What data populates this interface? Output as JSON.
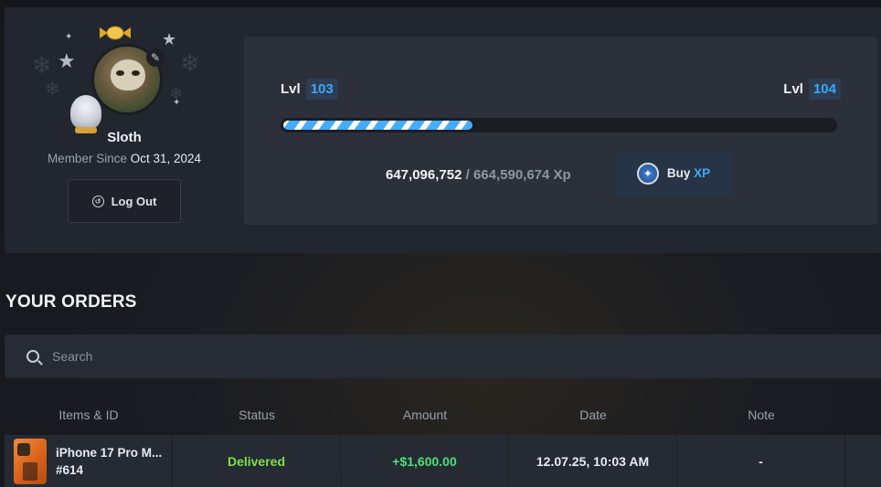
{
  "profile": {
    "username": "Sloth",
    "member_since_label": "Member Since",
    "member_since_date": "Oct 31, 2024",
    "logout_label": "Log Out"
  },
  "xp": {
    "level_label": "Lvl",
    "current_level": "103",
    "next_level": "104",
    "current_xp": "647,096,752",
    "separator": "/",
    "target_xp": "664,590,674 Xp",
    "progress_fraction": 0.35,
    "buy_label": "Buy",
    "buy_accent": "XP"
  },
  "orders": {
    "title": "YOUR ORDERS",
    "search_placeholder": "Search",
    "columns": [
      "Items & ID",
      "Status",
      "Amount",
      "Date",
      "Note"
    ],
    "rows": [
      {
        "item_name": "iPhone 17 Pro M...",
        "item_id": "#614",
        "status": "Delivered",
        "amount": "+$1,600.00",
        "date": "12.07.25, 10:03 AM",
        "note": "-"
      }
    ]
  },
  "colors": {
    "accent_blue": "#3aa8ff",
    "status_green": "#7ee04b",
    "amount_green": "#4ee07a"
  }
}
